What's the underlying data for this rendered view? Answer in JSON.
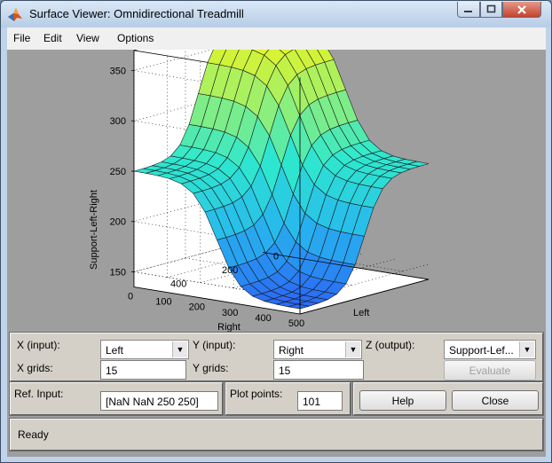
{
  "window": {
    "title": "Surface Viewer: Omnidirectional Treadmill",
    "controls": {
      "minimize": "minimize-icon",
      "maximize": "maximize-icon",
      "close": "close-icon"
    }
  },
  "menu": [
    "File",
    "Edit",
    "View",
    "Options"
  ],
  "plot": {
    "z_label": "Support-Left-Right",
    "x_label": "Right",
    "y_label": "Left",
    "z_ticks": [
      "150",
      "200",
      "250",
      "300",
      "350"
    ],
    "right_ticks": [
      "0",
      "100",
      "200",
      "300",
      "400",
      "500"
    ],
    "left_ticks": [
      "0",
      "200",
      "400"
    ]
  },
  "controls": {
    "x_input_label": "X (input):",
    "x_input_value": "Left",
    "y_input_label": "Y (input):",
    "y_input_value": "Right",
    "z_output_label": "Z (output):",
    "z_output_value": "Support-Lef...",
    "x_grids_label": "X grids:",
    "x_grids_value": "15",
    "y_grids_label": "Y grids:",
    "y_grids_value": "15",
    "evaluate_label": "Evaluate"
  },
  "ref": {
    "ref_input_label": "Ref. Input:",
    "ref_input_value": "[NaN NaN 250 250]",
    "plot_points_label": "Plot points:",
    "plot_points_value": "101",
    "help_label": "Help",
    "close_label": "Close"
  },
  "status": {
    "text": "Ready"
  },
  "chart_data": {
    "type": "surface",
    "xlabel": "Right",
    "ylabel": "Left",
    "zlabel": "Support-Left-Right",
    "x_ticks": [
      0,
      100,
      200,
      300,
      400,
      500
    ],
    "y_ticks": [
      0,
      200,
      400
    ],
    "z_ticks": [
      150,
      200,
      250,
      300,
      350
    ],
    "xlim": [
      0,
      500
    ],
    "ylim": [
      0,
      500
    ],
    "zlim": [
      150,
      370
    ],
    "grid": true,
    "colormap": [
      "#2a6cf5",
      "#27b7ee",
      "#2ee8cf",
      "#9ef06a",
      "#f2f51a"
    ]
  }
}
